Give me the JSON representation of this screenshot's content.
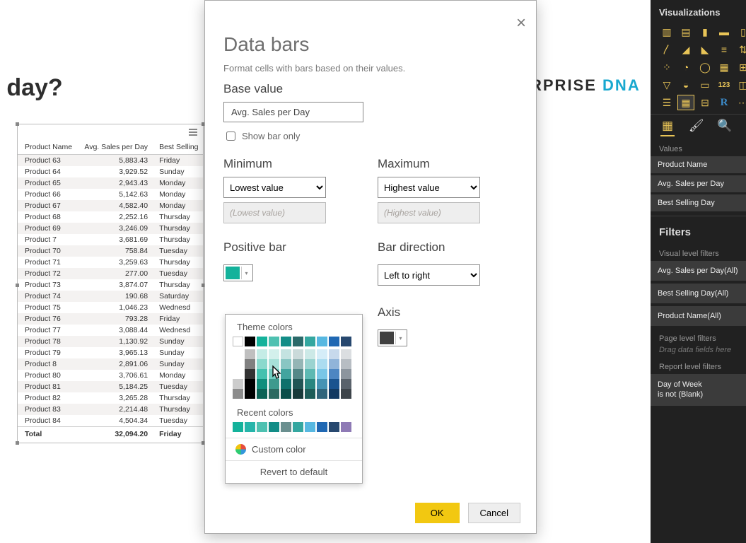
{
  "page": {
    "heading_fragment": "lling day?",
    "brand_left": "NTERPRISE",
    "brand_right": "DNA"
  },
  "table": {
    "columns": [
      "Product Name",
      "Avg. Sales per Day",
      "Best Selling"
    ],
    "rows": [
      {
        "product": "Product 63",
        "avg": "5,883.43",
        "day": "Friday"
      },
      {
        "product": "Product 64",
        "avg": "3,929.52",
        "day": "Sunday"
      },
      {
        "product": "Product 65",
        "avg": "2,943.43",
        "day": "Monday"
      },
      {
        "product": "Product 66",
        "avg": "5,142.63",
        "day": "Monday"
      },
      {
        "product": "Product 67",
        "avg": "4,582.40",
        "day": "Monday"
      },
      {
        "product": "Product 68",
        "avg": "2,252.16",
        "day": "Thursday"
      },
      {
        "product": "Product 69",
        "avg": "3,246.09",
        "day": "Thursday"
      },
      {
        "product": "Product 7",
        "avg": "3,681.69",
        "day": "Thursday"
      },
      {
        "product": "Product 70",
        "avg": "758.84",
        "day": "Tuesday"
      },
      {
        "product": "Product 71",
        "avg": "3,259.63",
        "day": "Thursday"
      },
      {
        "product": "Product 72",
        "avg": "277.00",
        "day": "Tuesday"
      },
      {
        "product": "Product 73",
        "avg": "3,874.07",
        "day": "Thursday"
      },
      {
        "product": "Product 74",
        "avg": "190.68",
        "day": "Saturday"
      },
      {
        "product": "Product 75",
        "avg": "1,046.23",
        "day": "Wednesd"
      },
      {
        "product": "Product 76",
        "avg": "793.28",
        "day": "Friday"
      },
      {
        "product": "Product 77",
        "avg": "3,088.44",
        "day": "Wednesd"
      },
      {
        "product": "Product 78",
        "avg": "1,130.92",
        "day": "Sunday"
      },
      {
        "product": "Product 79",
        "avg": "3,965.13",
        "day": "Sunday"
      },
      {
        "product": "Product 8",
        "avg": "2,891.06",
        "day": "Sunday"
      },
      {
        "product": "Product 80",
        "avg": "3,706.61",
        "day": "Monday"
      },
      {
        "product": "Product 81",
        "avg": "5,184.25",
        "day": "Tuesday"
      },
      {
        "product": "Product 82",
        "avg": "3,265.28",
        "day": "Thursday"
      },
      {
        "product": "Product 83",
        "avg": "2,214.48",
        "day": "Thursday"
      },
      {
        "product": "Product 84",
        "avg": "4,504.34",
        "day": "Tuesday"
      }
    ],
    "total_label": "Total",
    "total_avg": "32,094.20",
    "total_day": "Friday"
  },
  "dialog": {
    "title": "Data bars",
    "description": "Format cells with bars based on their values.",
    "base_label": "Base value",
    "base_value": "Avg. Sales per Day",
    "show_bar_only": "Show bar only",
    "min_label": "Minimum",
    "max_label": "Maximum",
    "min_select": "Lowest value",
    "max_select": "Highest value",
    "min_placeholder": "(Lowest value)",
    "max_placeholder": "(Highest value)",
    "positive_label": "Positive bar",
    "direction_label": "Bar direction",
    "direction_value": "Left to right",
    "axis_label": "Axis",
    "ok": "OK",
    "cancel": "Cancel",
    "positive_color": "#14b29b",
    "axis_color": "#404040"
  },
  "picker": {
    "theme_label": "Theme colors",
    "row1": [
      "#ffffff",
      "#000000",
      "#14b29b",
      "#4ec1b1",
      "#138d87",
      "#2b6a6a",
      "#34a7a0",
      "#57b8e1",
      "#2068b3",
      "#27486f"
    ],
    "tint_bases": [
      "#ffffff",
      "#000000",
      "#14b29b",
      "#4ec1b1",
      "#138d87",
      "#2b6a6a",
      "#34a7a0",
      "#57b8e1",
      "#2068b3",
      "#6f7b86"
    ],
    "recent_label": "Recent colors",
    "recent": [
      "#14b29b",
      "#26b5aa",
      "#4ec1b1",
      "#138d87",
      "#6a8f8f",
      "#34a7a0",
      "#57b8e1",
      "#2068b3",
      "#27486f",
      "#8e7ab5"
    ],
    "custom": "Custom color",
    "revert": "Revert to default"
  },
  "rpane": {
    "title": "Visualizations",
    "values_label": "Values",
    "fields": [
      "Product Name",
      "Avg. Sales per Day",
      "Best Selling Day"
    ],
    "filters_title": "Filters",
    "visual_filters_label": "Visual level filters",
    "visual_filters": [
      "Avg. Sales per Day(All)",
      "Best Selling Day(All)",
      "Product Name(All)"
    ],
    "page_filters_label": "Page level filters",
    "page_filters_hint": "Drag data fields here",
    "report_filters_label": "Report level filters",
    "report_filter_line1": "Day of Week",
    "report_filter_line2": "is not (Blank)"
  }
}
